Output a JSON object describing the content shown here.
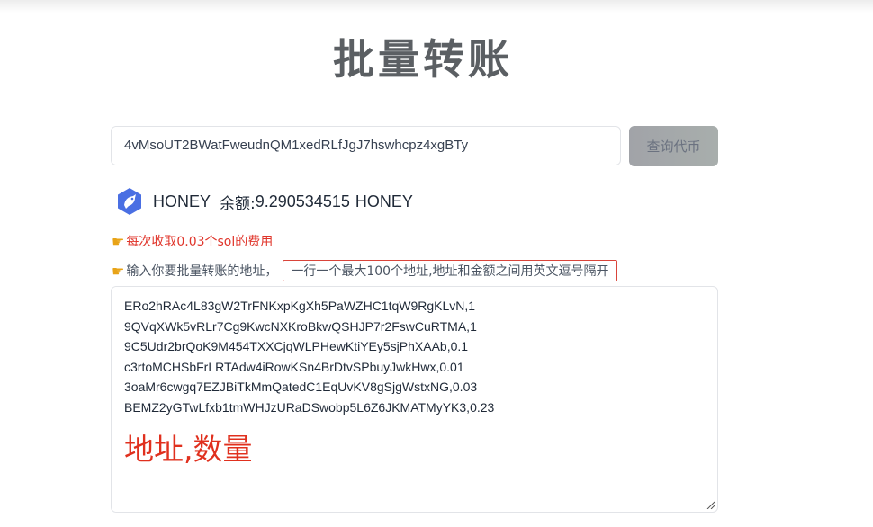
{
  "page": {
    "title": "批量转账"
  },
  "search": {
    "value": "4vMsoUT2BWatFweudnQM1xedRLfJgJ7hswhcpz4xgBTy",
    "button_label": "查询代币"
  },
  "token": {
    "icon": "honey-token-icon",
    "name": "HONEY",
    "balance_label": "余额:",
    "balance_value": "9.290534515",
    "balance_unit": "HONEY"
  },
  "fee_note": "每次收取0.03个sol的费用",
  "input_label": "输入你要批量转账的地址",
  "separator": "，",
  "hint": "一行一个最大100个地址,地址和金额之间用英文逗号隔开",
  "entries": [
    "ERo2hRAc4L83gW2TrFNKxpKgXh5PaWZHC1tqW9RgKLvN,1",
    "9QVqXWk5vRLr7Cg9KwcNXKroBkwQSHJP7r2FswCuRTMA,1",
    "9C5Udr2brQoK9M454TXXCjqWLPHewKtiYEy5sjPhXAAb,0.1",
    "c3rtoMCHSbFrLRTAdw4iRowKSn4BrDtvSPbuyJwkHwx,0.01",
    "3oaMr6cwgq7EZJBiTkMmQatedC1EqUvKV8gSjgWstxNG,0.03",
    "BEMZ2yGTwLfxb1tmWHJzURaDSwobp5L6Z6JKMATMyYK3,0.23"
  ],
  "textarea_overlay": "地址,数量",
  "colors": {
    "accent_red": "#e0301e",
    "title_gray": "#5b5f63",
    "token_blue": "#4a6fe3"
  }
}
